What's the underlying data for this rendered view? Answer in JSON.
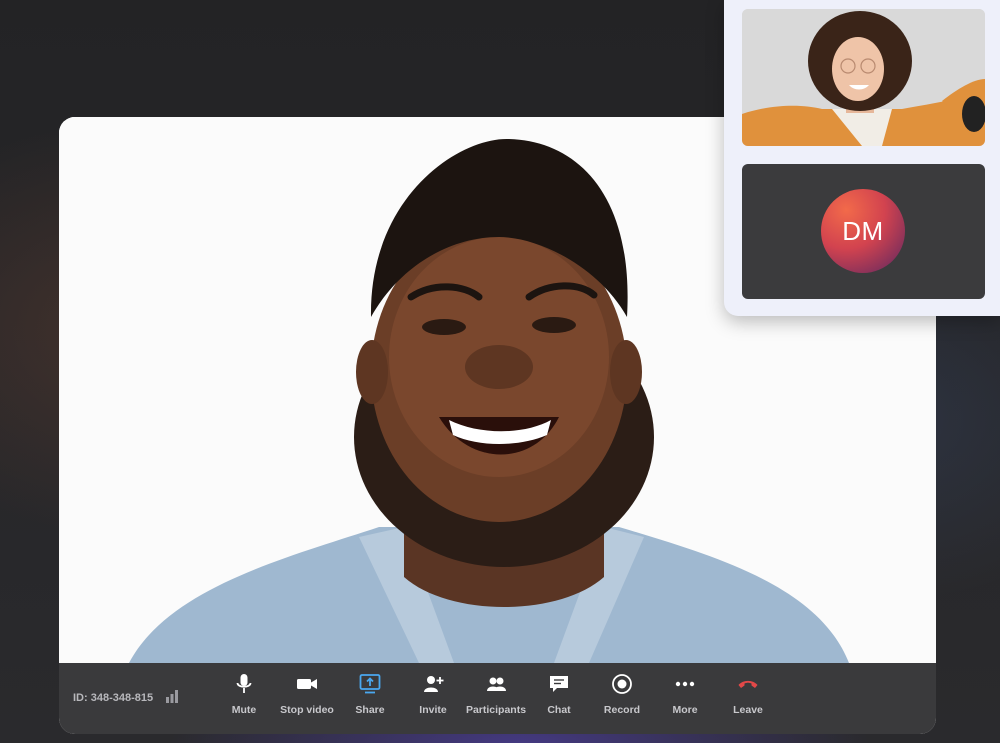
{
  "toolbar": {
    "meeting_id": "ID: 348-348-815",
    "controls": [
      {
        "label": "Mute",
        "icon": "microphone-icon"
      },
      {
        "label": "Stop video",
        "icon": "video-camera-icon"
      },
      {
        "label": "Share",
        "icon": "share-screen-icon"
      },
      {
        "label": "Invite",
        "icon": "add-person-icon"
      },
      {
        "label": "Participants",
        "icon": "participants-icon"
      },
      {
        "label": "Chat",
        "icon": "chat-icon"
      },
      {
        "label": "Record",
        "icon": "record-icon"
      },
      {
        "label": "More",
        "icon": "more-dots-icon"
      },
      {
        "label": "Leave",
        "icon": "hang-up-icon"
      }
    ]
  },
  "participants": {
    "avatar_initials": "DM"
  },
  "colors": {
    "share_accent": "#4aa8f0",
    "leave_red": "#e24848",
    "toolbar_bg": "#3a3a3c",
    "avatar_gradient_start": "#f26a4a",
    "avatar_gradient_end": "#5a2a55"
  }
}
